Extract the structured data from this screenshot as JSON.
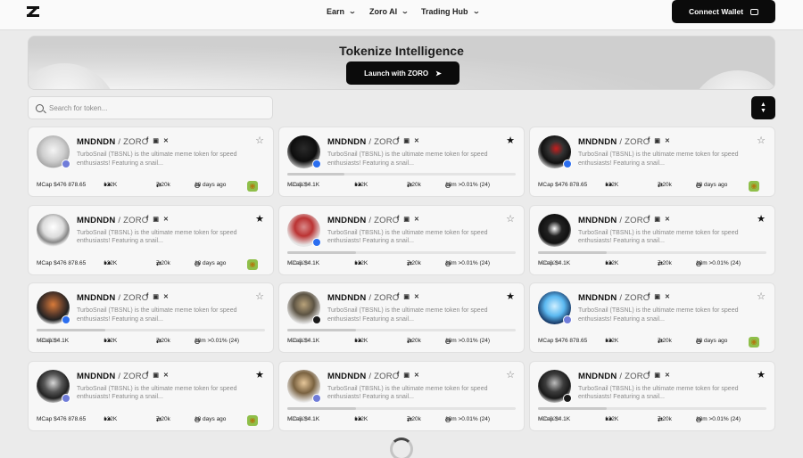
{
  "nav": {
    "menus": [
      {
        "label": "Earn"
      },
      {
        "label": "Zoro AI"
      },
      {
        "label": "Trading Hub"
      }
    ],
    "wallet_label": "Connect Wallet"
  },
  "hero": {
    "title": "Tokenize Intelligence",
    "button_label": "Launch with ZORO"
  },
  "search": {
    "placeholder": "Search for token..."
  },
  "colors": {
    "accent": "#0b0b0b",
    "background": "#ebebeb",
    "card": "#f7f7f7"
  },
  "cards": [
    {
      "name": "MNDNDN",
      "pair": "/ ZORO",
      "desc": "TurboSnail (TBSNL) is the ultimate meme token for speed enthusiasts! Featuring a snail...",
      "mcap": "MCap $476 878.65",
      "holders": "122K",
      "txns": "7.20k",
      "time": "18 days ago",
      "starred": false,
      "progress": 0,
      "chain": "ethereum",
      "avatar": "light"
    },
    {
      "name": "MNDNDN",
      "pair": "/ ZORO",
      "desc": "TurboSnail (TBSNL) is the ultimate meme token for speed enthusiasts! Featuring a snail...",
      "mcap": "MCap $4.1K",
      "change": "+20.52%",
      "holders": "122K",
      "txns": "7.20k",
      "time": "18m >0.01% (24)",
      "starred": true,
      "progress": 0.25,
      "chain": "base",
      "avatar": "dark"
    },
    {
      "name": "MNDNDN",
      "pair": "/ ZORO",
      "desc": "TurboSnail (TBSNL) is the ultimate meme token for speed enthusiasts! Featuring a snail...",
      "mcap": "MCap $476 878.65",
      "holders": "122K",
      "txns": "7.20k",
      "time": "18 days ago",
      "starred": false,
      "progress": 0,
      "chain": "base",
      "avatar": "red"
    },
    {
      "name": "MNDNDN",
      "pair": "/ ZORO",
      "desc": "TurboSnail (TBSNL) is the ultimate meme token for speed enthusiasts! Featuring a snail...",
      "mcap": "MCap $476 878.65",
      "holders": "122K",
      "txns": "7.20k",
      "time": "18 days ago",
      "starred": true,
      "progress": 0,
      "chain": "none",
      "avatar": "sketch"
    },
    {
      "name": "MNDNDN",
      "pair": "/ ZORO",
      "desc": "TurboSnail (TBSNL) is the ultimate meme token for speed enthusiasts! Featuring a snail...",
      "mcap": "MCap $4.1K",
      "change": "+20.52%",
      "holders": "122K",
      "txns": "7.20k",
      "time": "18m >0.01% (24)",
      "starred": false,
      "progress": 0.3,
      "chain": "base",
      "avatar": "redhair"
    },
    {
      "name": "MNDNDN",
      "pair": "/ ZORO",
      "desc": "TurboSnail (TBSNL) is the ultimate meme token for speed enthusiasts! Featuring a snail...",
      "mcap": "MCap $4.1K",
      "change": "+20.52%",
      "holders": "122K",
      "txns": "7.20k",
      "time": "18m >0.01% (24)",
      "starred": true,
      "progress": 0.3,
      "chain": "none",
      "avatar": "skull"
    },
    {
      "name": "MNDNDN",
      "pair": "/ ZORO",
      "desc": "TurboSnail (TBSNL) is the ultimate meme token for speed enthusiasts! Featuring a snail...",
      "mcap": "MCap $4.1K",
      "change": "+20.52%",
      "holders": "122K",
      "txns": "7.20k",
      "time": "18m >0.01% (24)",
      "starred": false,
      "progress": 0.3,
      "chain": "base",
      "avatar": "orange"
    },
    {
      "name": "MNDNDN",
      "pair": "/ ZORO",
      "desc": "TurboSnail (TBSNL) is the ultimate meme token for speed enthusiasts! Featuring a snail...",
      "mcap": "MCap $4.1K",
      "change": "+20.52%",
      "holders": "122K",
      "txns": "7.20k",
      "time": "18m >0.01% (24)",
      "starred": true,
      "progress": 0.3,
      "chain": "bnb",
      "avatar": "olive"
    },
    {
      "name": "MNDNDN",
      "pair": "/ ZORO",
      "desc": "TurboSnail (TBSNL) is the ultimate meme token for speed enthusiasts! Featuring a snail...",
      "mcap": "MCap $476 878.65",
      "holders": "122K",
      "txns": "7.20k",
      "time": "18 days ago",
      "starred": false,
      "progress": 0,
      "chain": "ethereum",
      "avatar": "blue"
    },
    {
      "name": "MNDNDN",
      "pair": "/ ZORO",
      "desc": "TurboSnail (TBSNL) is the ultimate meme token for speed enthusiasts! Featuring a snail...",
      "mcap": "MCap $476 878.65",
      "holders": "122K",
      "txns": "7.20k",
      "time": "18 days ago",
      "starred": true,
      "progress": 0,
      "chain": "ethereum",
      "avatar": "grey"
    },
    {
      "name": "MNDNDN",
      "pair": "/ ZORO",
      "desc": "TurboSnail (TBSNL) is the ultimate meme token for speed enthusiasts! Featuring a snail...",
      "mcap": "MCap $4.1K",
      "change": "+20.52%",
      "holders": "122K",
      "txns": "7.20k",
      "time": "18m >0.01% (24)",
      "starred": false,
      "progress": 0.3,
      "chain": "ethereum",
      "avatar": "tan"
    },
    {
      "name": "MNDNDN",
      "pair": "/ ZORO",
      "desc": "TurboSnail (TBSNL) is the ultimate meme token for speed enthusiasts! Featuring a snail...",
      "mcap": "MCap $4.1K",
      "change": "+20.52%",
      "holders": "122K",
      "txns": "7.20k",
      "time": "18m >0.01% (24)",
      "starred": true,
      "progress": 0.3,
      "chain": "bnb",
      "avatar": "darkgrey"
    }
  ]
}
